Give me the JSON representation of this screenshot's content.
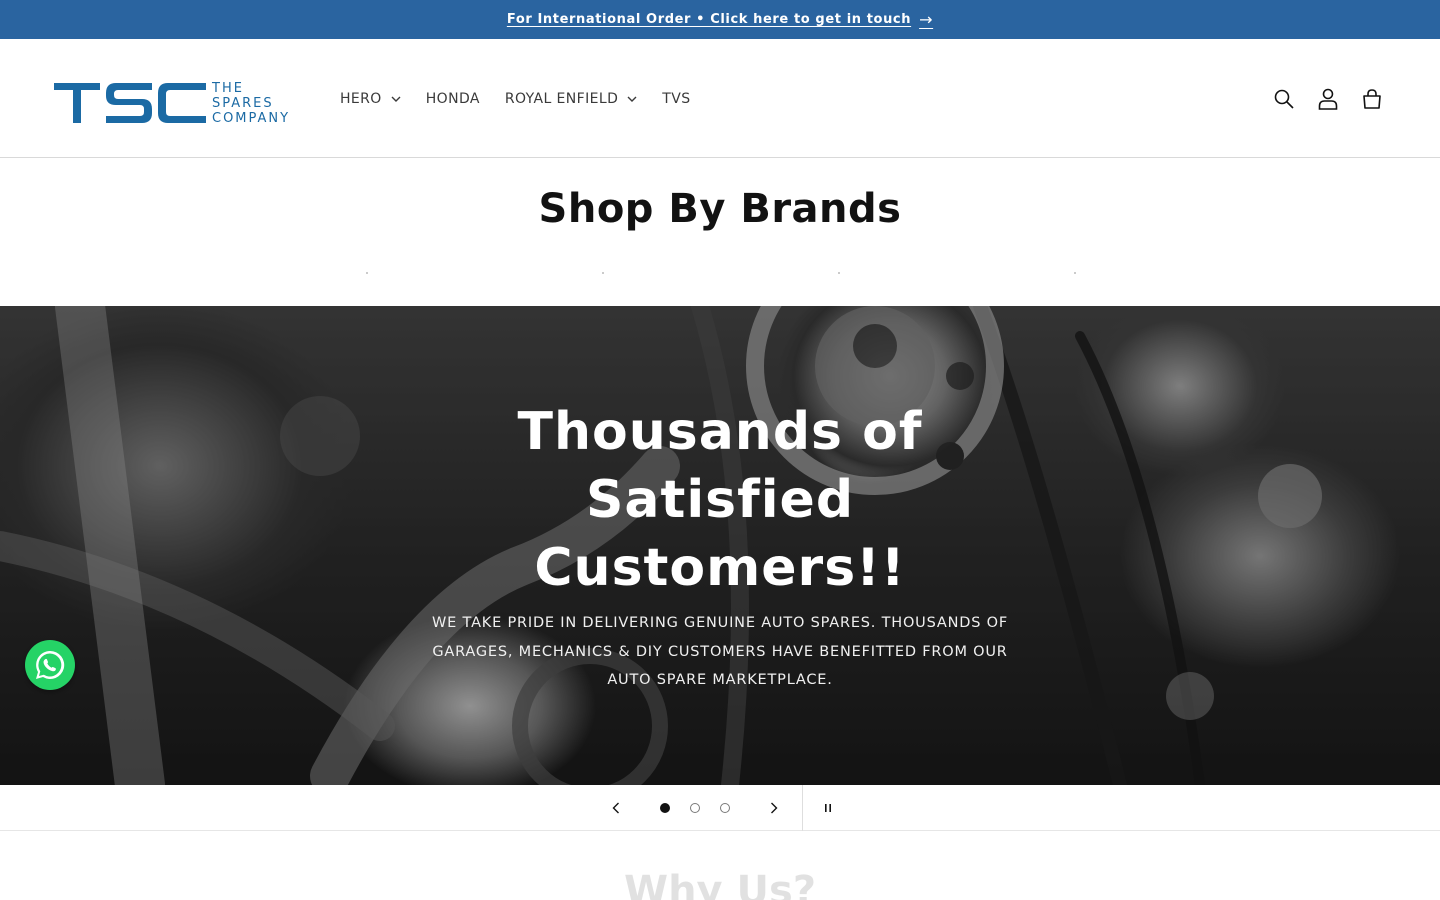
{
  "announcement": {
    "text": "For International Order • Click here to get in touch",
    "arrow": "→"
  },
  "header": {
    "logo": {
      "mark": "TSC",
      "tagline": [
        "THE",
        "SPARES",
        "COMPANY"
      ],
      "color": "#1b6aa4"
    },
    "nav": [
      {
        "label": "HERO",
        "has_dropdown": true
      },
      {
        "label": "HONDA",
        "has_dropdown": false
      },
      {
        "label": "ROYAL ENFIELD",
        "has_dropdown": true
      },
      {
        "label": "TVS",
        "has_dropdown": false
      }
    ],
    "icons": [
      "search-icon",
      "account-icon",
      "cart-icon"
    ]
  },
  "brands": {
    "title": "Shop By Brands"
  },
  "hero": {
    "heading": "Thousands of Satisfied Customers!!",
    "subtext": "WE TAKE PRIDE IN DELIVERING GENUINE AUTO SPARES. THOUSANDS OF GARAGES, MECHANICS & DIY CUSTOMERS HAVE BENEFITTED FROM OUR AUTO SPARE MARKETPLACE.",
    "slides_total": 3,
    "active_slide": 1
  },
  "next_section": {
    "title": "Why Us?"
  },
  "colors": {
    "announcement_bg": "#2a64a0",
    "whatsapp": "#25d366"
  }
}
